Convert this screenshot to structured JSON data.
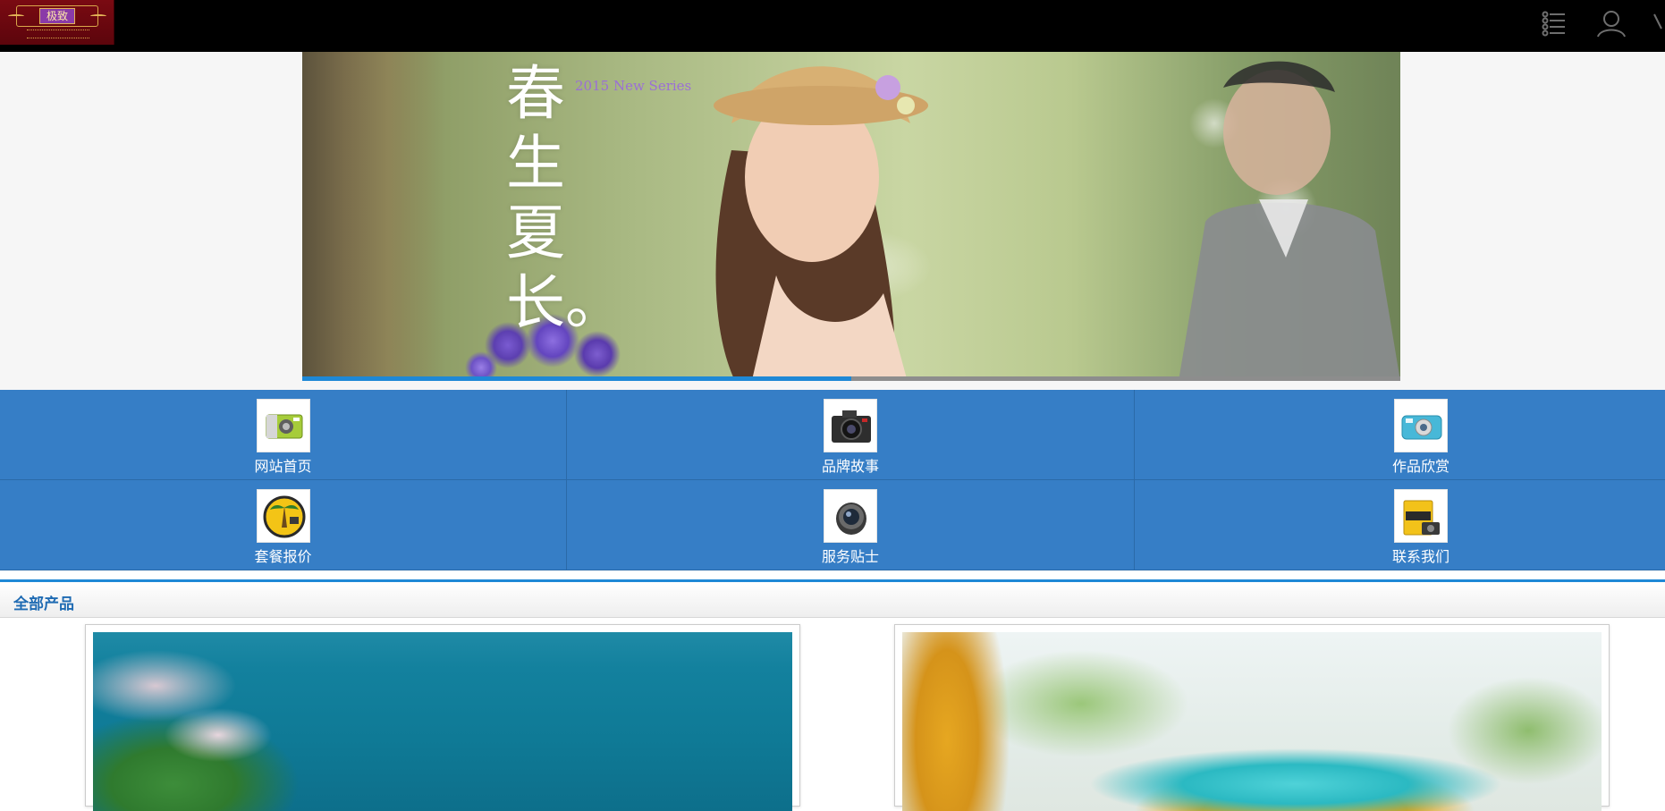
{
  "header": {
    "logo_text": "极致",
    "menu_icon": "list-menu-icon",
    "user_icon": "user-icon"
  },
  "banner": {
    "headline": "春生夏长。",
    "series": "2015 New Series",
    "progress": 0.5,
    "colors": {
      "progress": "#1e88d6",
      "track": "#8d8d8d"
    }
  },
  "nav": {
    "items": [
      {
        "label": "网站首页",
        "icon": "green-camera-icon"
      },
      {
        "label": "品牌故事",
        "icon": "dslr-camera-icon"
      },
      {
        "label": "作品欣赏",
        "icon": "blue-camera-icon"
      },
      {
        "label": "套餐报价",
        "icon": "palm-badge-icon"
      },
      {
        "label": "服务贴士",
        "icon": "lens-icon"
      },
      {
        "label": "联系我们",
        "icon": "folder-camera-icon"
      }
    ],
    "colors": {
      "background": "#367ec6"
    }
  },
  "section": {
    "title": "全部产品",
    "accent": "#1e88d6"
  },
  "products": [
    {
      "name": "product-card-seaside"
    },
    {
      "name": "product-card-bus"
    }
  ]
}
